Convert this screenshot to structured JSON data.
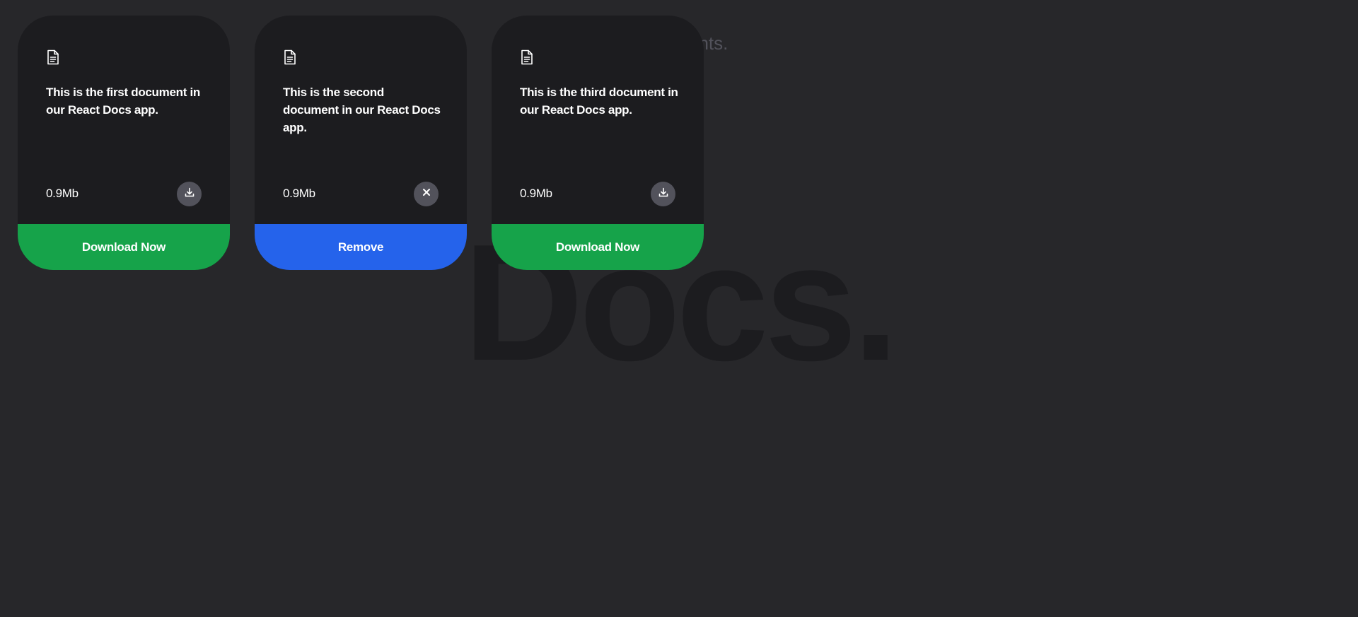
{
  "background": {
    "subtitle": "Documents.",
    "title": "Docs."
  },
  "colors": {
    "page_bg": "#27272a",
    "card_bg": "#1c1c1f",
    "green": "#16a34a",
    "blue": "#2563eb",
    "icon_button_bg": "#52525b"
  },
  "cards": [
    {
      "icon": "document-icon",
      "description": "This is the first document in our React Docs app.",
      "file_size": "0.9Mb",
      "action_icon": "download-icon",
      "tag_label": "Download Now",
      "tag_color": "green"
    },
    {
      "icon": "document-icon",
      "description": "This is the second document in our React Docs app.",
      "file_size": "0.9Mb",
      "action_icon": "close-icon",
      "tag_label": "Remove",
      "tag_color": "blue"
    },
    {
      "icon": "document-icon",
      "description": "This is the third document in our React Docs app.",
      "file_size": "0.9Mb",
      "action_icon": "download-icon",
      "tag_label": "Download Now",
      "tag_color": "green"
    }
  ]
}
